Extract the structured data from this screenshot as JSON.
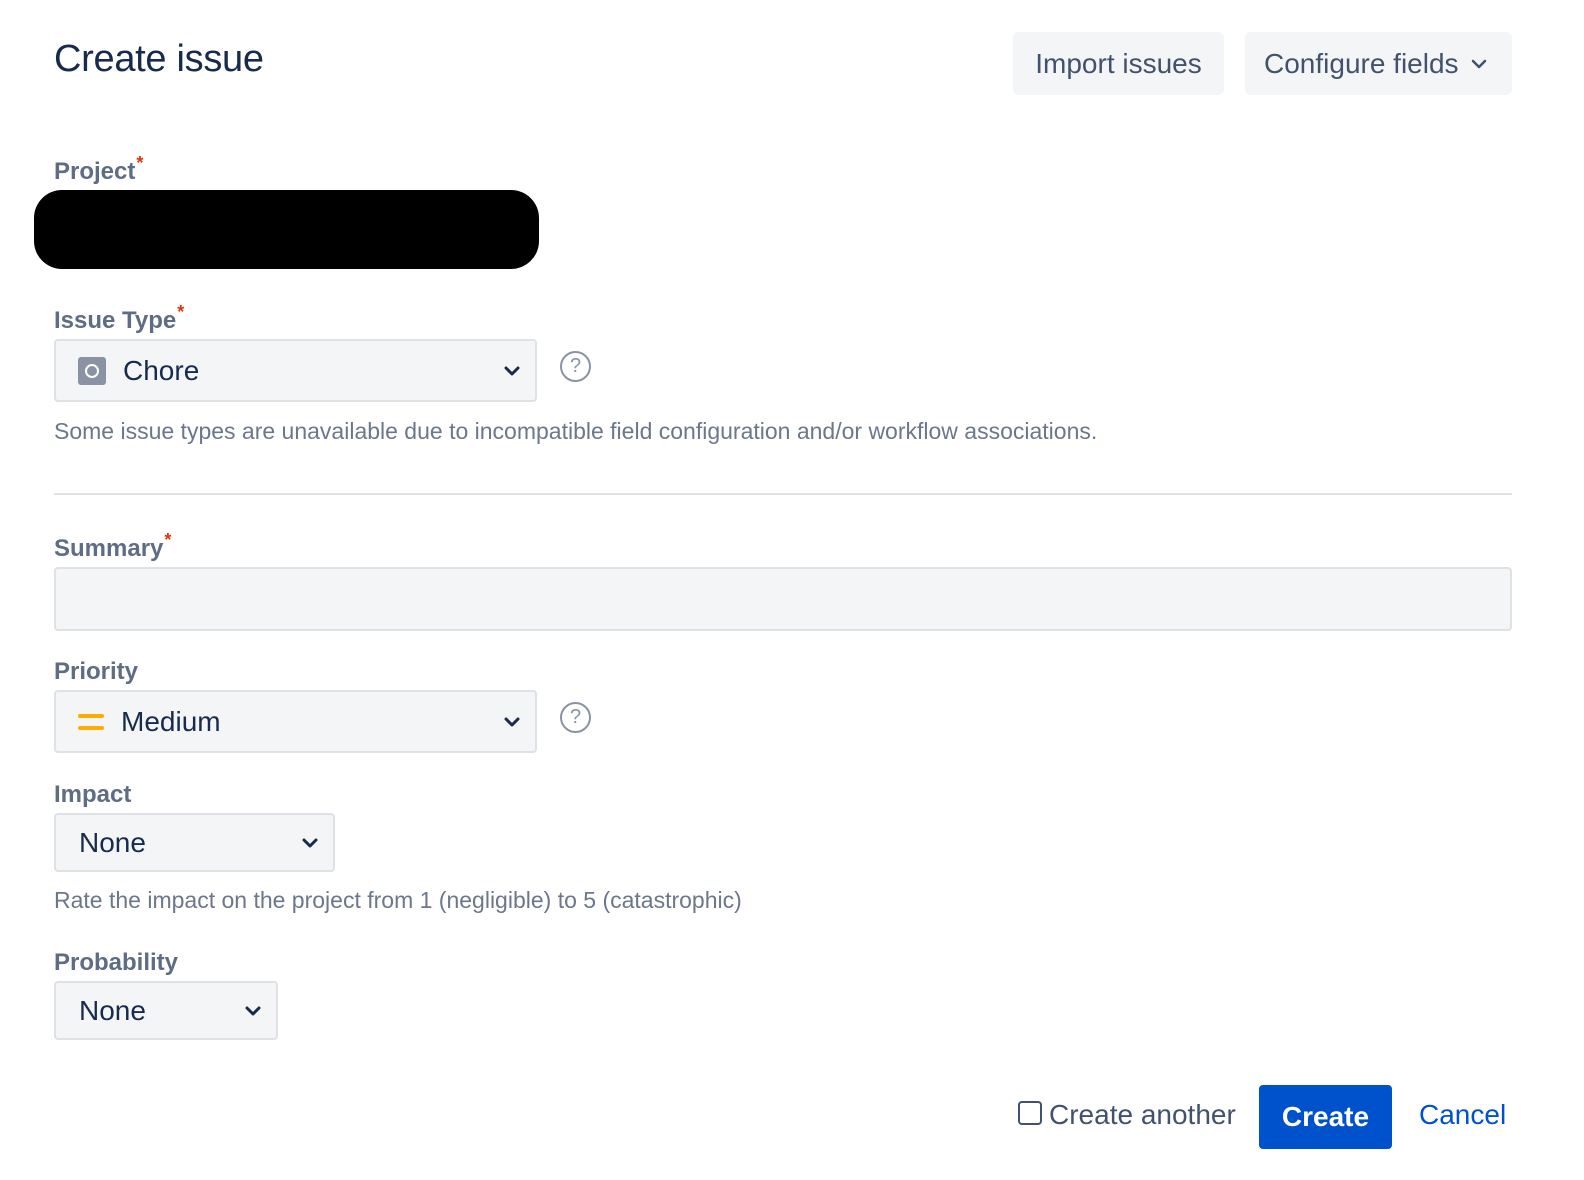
{
  "dialog": {
    "title": "Create issue",
    "import_label": "Import issues",
    "configure_label": "Configure fields"
  },
  "fields": {
    "project": {
      "label": "Project",
      "required_mark": "*"
    },
    "issue_type": {
      "label": "Issue Type",
      "required_mark": "*",
      "value": "Chore",
      "icon": "chore-icon",
      "help": "?",
      "note": "Some issue types are unavailable due to incompatible field configuration and/or workflow associations."
    },
    "summary": {
      "label": "Summary",
      "required_mark": "*",
      "value": ""
    },
    "priority": {
      "label": "Priority",
      "value": "Medium",
      "icon": "priority-medium-icon",
      "help": "?"
    },
    "impact": {
      "label": "Impact",
      "value": "None",
      "note": "Rate the impact on the project from 1 (negligible) to 5 (catastrophic)"
    },
    "probability": {
      "label": "Probability",
      "value": "None"
    }
  },
  "footer": {
    "create_another_label": "Create another",
    "create_another_checked": false,
    "create_label": "Create",
    "cancel_label": "Cancel"
  },
  "colors": {
    "primary": "#0052cc",
    "required": "#de350b",
    "priority_medium": "#ffab00",
    "text": "#172b4d",
    "muted": "#6b778c"
  }
}
